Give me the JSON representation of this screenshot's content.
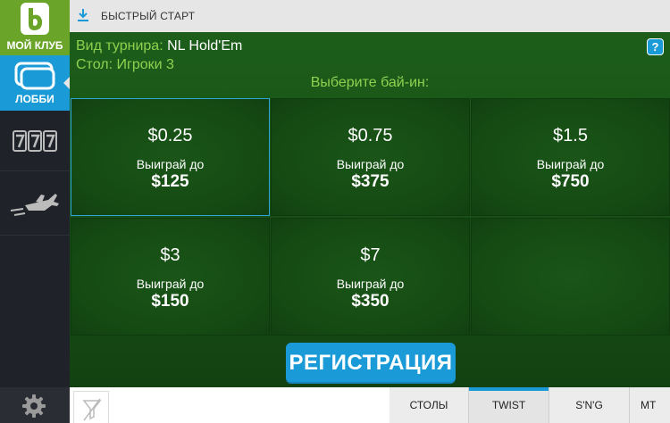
{
  "sidebar": {
    "club_label": "МОЙ КЛУБ",
    "lobby_label": "ЛОББИ"
  },
  "topbar": {
    "title": "БЫСТРЫЙ СТАРТ"
  },
  "info": {
    "tournament_label": "Вид турнира:",
    "tournament_value": "NL Hold'Em",
    "table_label": "Стол:",
    "table_value": "Игроки 3",
    "help_label": "?"
  },
  "prompt": "Выберите бай-ин:",
  "tiles": [
    {
      "buyin": "$0.25",
      "win_label": "Выиграй до",
      "win": "$125"
    },
    {
      "buyin": "$0.75",
      "win_label": "Выиграй до",
      "win": "$375"
    },
    {
      "buyin": "$1.5",
      "win_label": "Выиграй до",
      "win": "$750"
    },
    {
      "buyin": "$3",
      "win_label": "Выиграй до",
      "win": "$150"
    },
    {
      "buyin": "$7",
      "win_label": "Выиграй до",
      "win": "$350"
    }
  ],
  "register_label": "РЕГИСТРАЦИЯ",
  "tabs": [
    {
      "label": "СТОЛЫ"
    },
    {
      "label": "TWIST"
    },
    {
      "label": "S'N'G"
    },
    {
      "label": "MT"
    }
  ],
  "colors": {
    "accent_blue": "#1a9bd7",
    "club_green": "#6aa52a",
    "label_green": "#8fd14f"
  }
}
